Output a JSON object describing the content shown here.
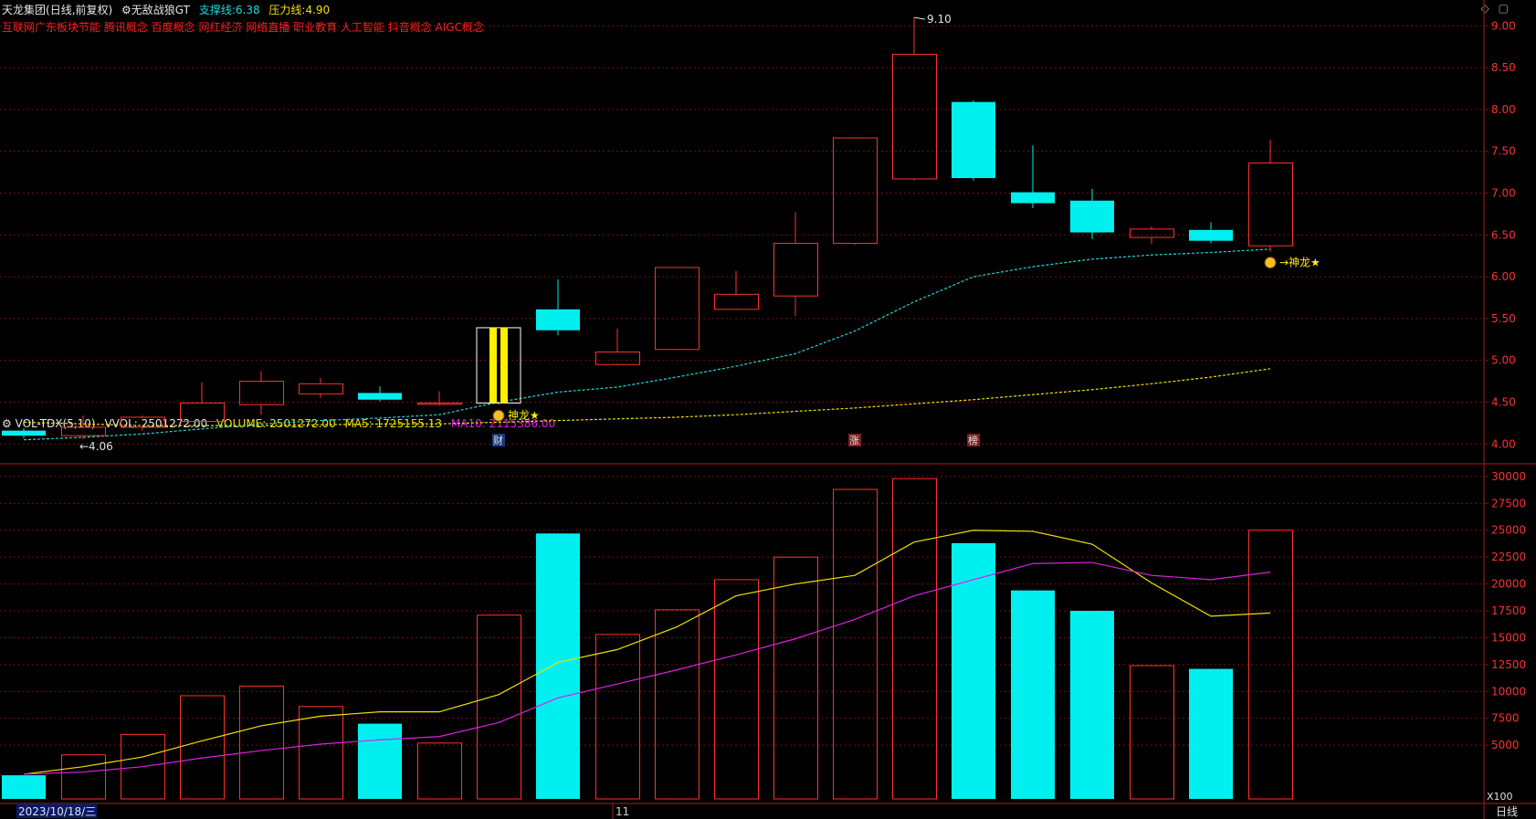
{
  "header": {
    "stock_name": "天龙集团",
    "period": "(日线,前复权)",
    "indicator": "无敌战狼GT",
    "support_label": "支撑线:",
    "support_value": "6.38",
    "pressure_label": "压力线:",
    "pressure_value": "4.90",
    "concepts": "互联网广东板块节能 腾讯概念 百度概念 网红经济 网络直播 职业教育 人工智能 抖音概念 AIGC概念"
  },
  "vol_header": {
    "name": "VOL-TDX(5,10)",
    "vvol": "VVOL: 2501272.00",
    "volume": "VOLUME: 2501272.00",
    "ma5": "MA5: 1725155.13",
    "ma10": "MA10: 2115386.00"
  },
  "footer": {
    "date": "2023/10/18/三",
    "month_mark": "11",
    "period_button": "日线",
    "vol_unit": "X100"
  },
  "window_icons": [
    "diamond-icon",
    "restore-icon"
  ],
  "colors": {
    "up": "#ff3030",
    "down": "#00f0f0",
    "ma_cyan": "#20d8d8",
    "ma_yellow": "#f0e000",
    "vol_ma5": "#f0e000",
    "vol_ma10": "#e020e0",
    "grid": "#7a1010",
    "special": "#ffee00"
  },
  "chart_data": [
    {
      "type": "candlestick",
      "y_ticks": [
        "9.00",
        "8.50",
        "8.00",
        "7.50",
        "7.00",
        "6.50",
        "6.00",
        "5.50",
        "5.00",
        "4.50",
        "4.00"
      ],
      "ylim": [
        3.85,
        9.2
      ],
      "candles": [
        {
          "o": 4.16,
          "h": 4.19,
          "l": 4.07,
          "c": 4.1
        },
        {
          "o": 4.1,
          "h": 4.34,
          "l": 4.06,
          "c": 4.2
        },
        {
          "o": 4.2,
          "h": 4.34,
          "l": 4.16,
          "c": 4.32
        },
        {
          "o": 4.27,
          "h": 4.74,
          "l": 4.26,
          "c": 4.49
        },
        {
          "o": 4.47,
          "h": 4.87,
          "l": 4.35,
          "c": 4.75
        },
        {
          "o": 4.6,
          "h": 4.79,
          "l": 4.55,
          "c": 4.72
        },
        {
          "o": 4.61,
          "h": 4.69,
          "l": 4.51,
          "c": 4.53
        },
        {
          "o": 4.48,
          "h": 4.63,
          "l": 4.46,
          "c": 4.49
        },
        {
          "o": 4.49,
          "h": 5.39,
          "l": 4.47,
          "c": 5.39,
          "special": true
        },
        {
          "o": 5.61,
          "h": 5.97,
          "l": 5.3,
          "c": 5.36
        },
        {
          "o": 4.95,
          "h": 5.38,
          "l": 4.94,
          "c": 5.1
        },
        {
          "o": 5.13,
          "h": 6.11,
          "l": 5.12,
          "c": 6.11
        },
        {
          "o": 5.61,
          "h": 6.07,
          "l": 5.6,
          "c": 5.79
        },
        {
          "o": 5.77,
          "h": 6.77,
          "l": 5.53,
          "c": 6.4
        },
        {
          "o": 6.4,
          "h": 7.66,
          "l": 6.38,
          "c": 7.66
        },
        {
          "o": 7.17,
          "h": 9.1,
          "l": 7.15,
          "c": 8.66
        },
        {
          "o": 8.09,
          "h": 8.11,
          "l": 7.15,
          "c": 7.18
        },
        {
          "o": 7.01,
          "h": 7.57,
          "l": 6.82,
          "c": 6.88
        },
        {
          "o": 6.91,
          "h": 7.05,
          "l": 6.45,
          "c": 6.53
        },
        {
          "o": 6.47,
          "h": 6.6,
          "l": 6.39,
          "c": 6.57
        },
        {
          "o": 6.56,
          "h": 6.65,
          "l": 6.4,
          "c": 6.43
        },
        {
          "o": 6.37,
          "h": 7.64,
          "l": 6.3,
          "c": 7.36
        }
      ],
      "ma_cyan": [
        4.05,
        4.08,
        4.12,
        4.18,
        4.24,
        4.28,
        4.31,
        4.35,
        4.5,
        4.62,
        4.68,
        4.8,
        4.93,
        5.08,
        5.35,
        5.7,
        6.0,
        6.12,
        6.21,
        6.26,
        6.29,
        6.33
      ],
      "ma_yellow": [
        4.26,
        4.24,
        4.22,
        4.22,
        4.22,
        4.23,
        4.24,
        4.24,
        4.26,
        4.28,
        4.3,
        4.32,
        4.35,
        4.39,
        4.43,
        4.48,
        4.53,
        4.59,
        4.65,
        4.72,
        4.8,
        4.9
      ],
      "annotations": [
        {
          "index": 1,
          "text": "←4.06"
        },
        {
          "index": 15,
          "text": "9.10"
        },
        {
          "index": 8,
          "text": "神龙★"
        },
        {
          "index": 21,
          "text": "→神龙★"
        }
      ],
      "event_markers": [
        {
          "index": 8,
          "text": "财"
        },
        {
          "index": 14,
          "text": "涨"
        },
        {
          "index": 16,
          "text": "榜"
        }
      ]
    },
    {
      "type": "bar",
      "y_ticks": [
        "30000",
        "27500",
        "25000",
        "22500",
        "20000",
        "17500",
        "15000",
        "12500",
        "10000",
        "7500",
        "5000"
      ],
      "ylim": [
        0,
        30500
      ],
      "volumes": [
        2200,
        4100,
        6000,
        9600,
        10500,
        8600,
        7000,
        5200,
        17100,
        24700,
        15300,
        17600,
        20400,
        22500,
        28800,
        29800,
        23800,
        19400,
        17500,
        12400,
        12100,
        25000
      ],
      "vol_up": [
        false,
        true,
        true,
        true,
        true,
        true,
        false,
        true,
        true,
        false,
        true,
        true,
        true,
        true,
        true,
        true,
        false,
        false,
        false,
        true,
        false,
        true
      ],
      "ma5": [
        2300,
        3000,
        3900,
        5400,
        6800,
        7700,
        8100,
        8100,
        9700,
        12700,
        13900,
        16000,
        18900,
        20000,
        20800,
        23900,
        25000,
        24900,
        23700,
        20100,
        17000,
        17300
      ],
      "ma10": [
        2300,
        2500,
        3000,
        3800,
        4500,
        5100,
        5500,
        5800,
        7100,
        9400,
        10700,
        12000,
        13400,
        14900,
        16700,
        18900,
        20400,
        21900,
        22000,
        20800,
        20400,
        21100
      ]
    }
  ]
}
